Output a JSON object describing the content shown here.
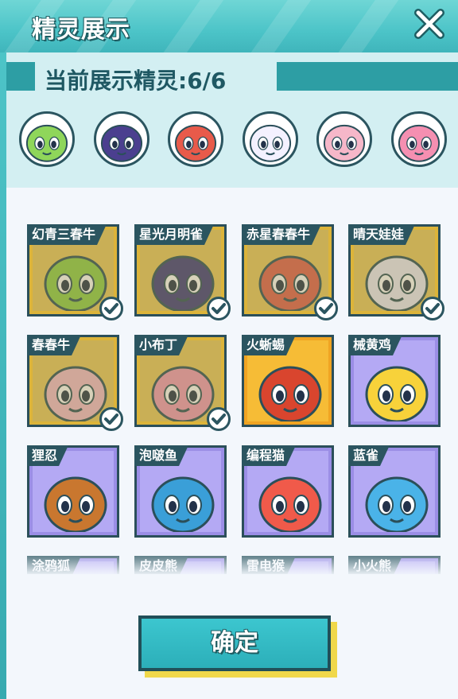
{
  "header": {
    "title": "精灵展示",
    "close_icon": "close-icon"
  },
  "showcase": {
    "label": "当前展示精灵:6/6",
    "slots": [
      {
        "icon": "green-cow-spirit-icon",
        "color": "#8fd65a"
      },
      {
        "icon": "purple-bird-spirit-icon",
        "color": "#4b3f8f"
      },
      {
        "icon": "red-cow-spirit-icon",
        "color": "#e85a4a"
      },
      {
        "icon": "white-egg-spirit-icon",
        "color": "#f4f1ff"
      },
      {
        "icon": "pink-cow-spirit-icon",
        "color": "#f6b7c9"
      },
      {
        "icon": "pink-bunny-spirit-icon",
        "color": "#f58fb1"
      }
    ]
  },
  "cards": [
    {
      "name": "幻青三春牛",
      "rarity": "gold",
      "owned": true,
      "char_color": "#8dcf4a"
    },
    {
      "name": "星光月明雀",
      "rarity": "gold",
      "owned": true,
      "char_color": "#3c3b7e"
    },
    {
      "name": "赤星春春牛",
      "rarity": "gold",
      "owned": true,
      "char_color": "#e06050"
    },
    {
      "name": "晴天娃娃",
      "rarity": "gold",
      "owned": true,
      "char_color": "#eceaf8"
    },
    {
      "name": "春春牛",
      "rarity": "gold",
      "owned": true,
      "char_color": "#f4bccb"
    },
    {
      "name": "小布丁",
      "rarity": "gold",
      "owned": true,
      "char_color": "#f29ab6"
    },
    {
      "name": "火蜥蜴",
      "rarity": "orange",
      "owned": false,
      "char_color": "#d9452e"
    },
    {
      "name": "械黄鸡",
      "rarity": "purple",
      "owned": false,
      "char_color": "#f7d23a"
    },
    {
      "name": "狸忍",
      "rarity": "purple",
      "owned": false,
      "char_color": "#c9772f"
    },
    {
      "name": "泡啵鱼",
      "rarity": "purple",
      "owned": false,
      "char_color": "#3a9fd8"
    },
    {
      "name": "编程猫",
      "rarity": "purple",
      "owned": false,
      "char_color": "#f05a4a"
    },
    {
      "name": "蓝雀",
      "rarity": "purple",
      "owned": false,
      "char_color": "#4ab3e8"
    },
    {
      "name": "涂鸦狐",
      "rarity": "purple",
      "owned": false,
      "char_color": "#f08a3a"
    },
    {
      "name": "皮皮熊",
      "rarity": "purple",
      "owned": false,
      "char_color": "#8a6a4a"
    },
    {
      "name": "雷电猴",
      "rarity": "purple",
      "owned": false,
      "char_color": "#f2c23a"
    },
    {
      "name": "小火熊",
      "rarity": "purple",
      "owned": false,
      "char_color": "#e8703a"
    }
  ],
  "confirm_label": "确定",
  "check_icon": "checkmark-icon"
}
